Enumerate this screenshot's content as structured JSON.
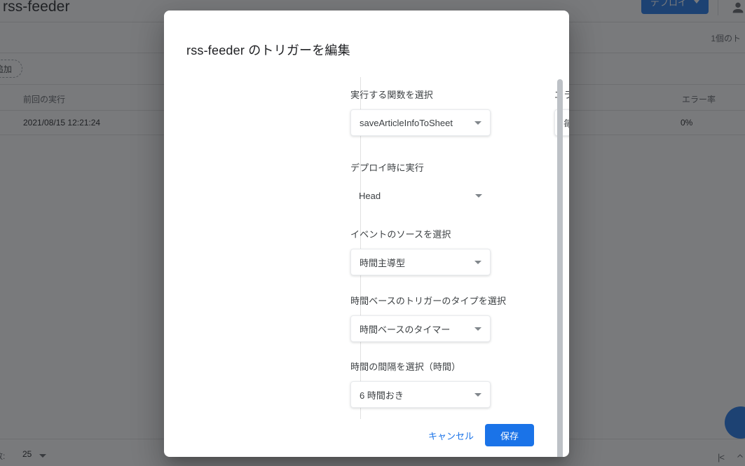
{
  "background": {
    "app_title": "rss-feeder",
    "deploy_button": "デプロイ",
    "trigger_count": "1個のト",
    "add_chip": "追加",
    "columns": {
      "last_run": "前回の実行",
      "error_rate": "エラー率"
    },
    "row": {
      "last_run": "2021/08/15 12:21:24",
      "error_rate": "0%"
    },
    "rows_per_page_label": "数:",
    "rows_per_page_value": "25",
    "page_first_icon": "|<",
    "accent_color": "#1a73e8"
  },
  "dialog": {
    "title": "rss-feeder のトリガーを編集",
    "left_column": {
      "function": {
        "label": "実行する関数を選択",
        "value": "saveArticleInfoToSheet"
      },
      "deployment": {
        "label": "デプロイ時に実行",
        "value": "Head"
      },
      "event_source": {
        "label": "イベントのソースを選択",
        "value": "時間主導型"
      },
      "trigger_type": {
        "label": "時間ベースのトリガーのタイプを選択",
        "value": "時間ベースのタイマー"
      },
      "interval": {
        "label": "時間の間隔を選択（時間）",
        "value": "6 時間おき"
      }
    },
    "right_column": {
      "notification": {
        "label": "エラー通知設定",
        "add_icon": "plus-icon",
        "value": "毎日通知を受け取る"
      }
    },
    "footer": {
      "cancel_label": "キャンセル",
      "save_label": "保存"
    }
  }
}
